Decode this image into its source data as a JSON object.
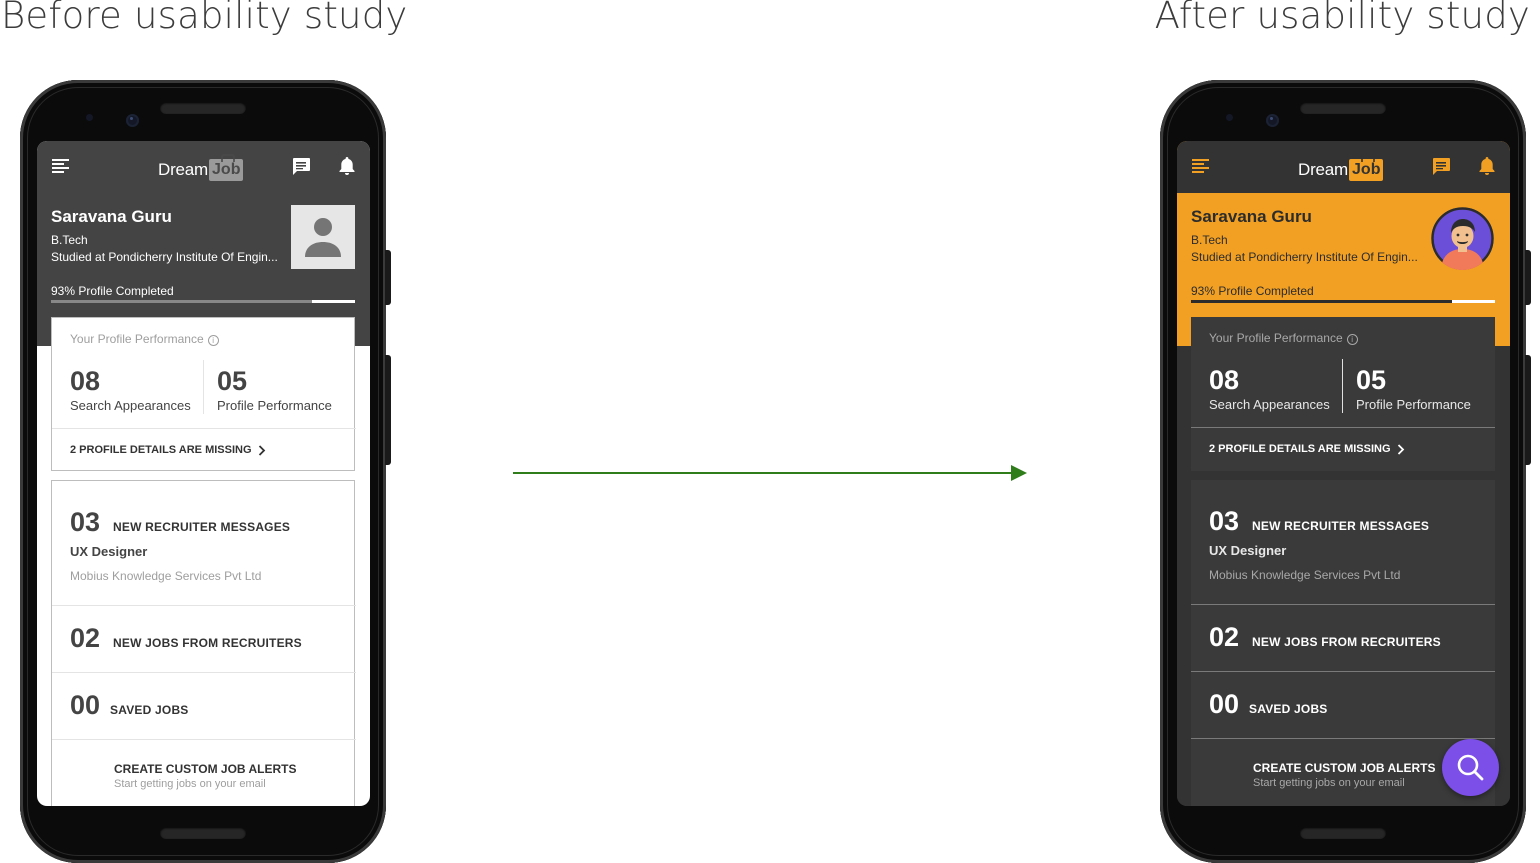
{
  "titles": {
    "before": "Before usability study",
    "after": "After usability study"
  },
  "app": {
    "logo_word": "Dream",
    "logo_box": "Job",
    "menu_icon": "menu-icon",
    "chat_icon": "chat-icon",
    "bell_icon": "bell-icon"
  },
  "profile": {
    "name": "Saravana Guru",
    "degree": "B.Tech",
    "college": "Studied at Pondicherry Institute Of Engin...",
    "progress_label": "93% Profile Completed",
    "progress_value": 0.93
  },
  "performance": {
    "title": "Your Profile Performance",
    "info_icon": "ⓘ",
    "stats": [
      {
        "value": "08",
        "label": "Search Appearances"
      },
      {
        "value": "05",
        "label": "Profile Performance"
      }
    ],
    "missing": "2 PROFILE DETAILS ARE MISSING"
  },
  "messages": {
    "recruiter_count": "03",
    "recruiter_label": "NEW RECRUITER MESSAGES",
    "job_title": "UX Designer",
    "company": "Mobius Knowledge Services Pvt Ltd",
    "jobs_count": "02",
    "jobs_label": "NEW JOBS FROM RECRUITERS",
    "saved_count": "00",
    "saved_label": "SAVED JOBS",
    "alert_title": "CREATE CUSTOM JOB ALERTS",
    "alert_sub": "Start getting jobs on your email"
  },
  "colors": {
    "before_header": "#444444",
    "after_header": "#f2a023",
    "after_background": "#333333",
    "fab": "#7b4fe8",
    "arrow": "#2e7d1a"
  }
}
